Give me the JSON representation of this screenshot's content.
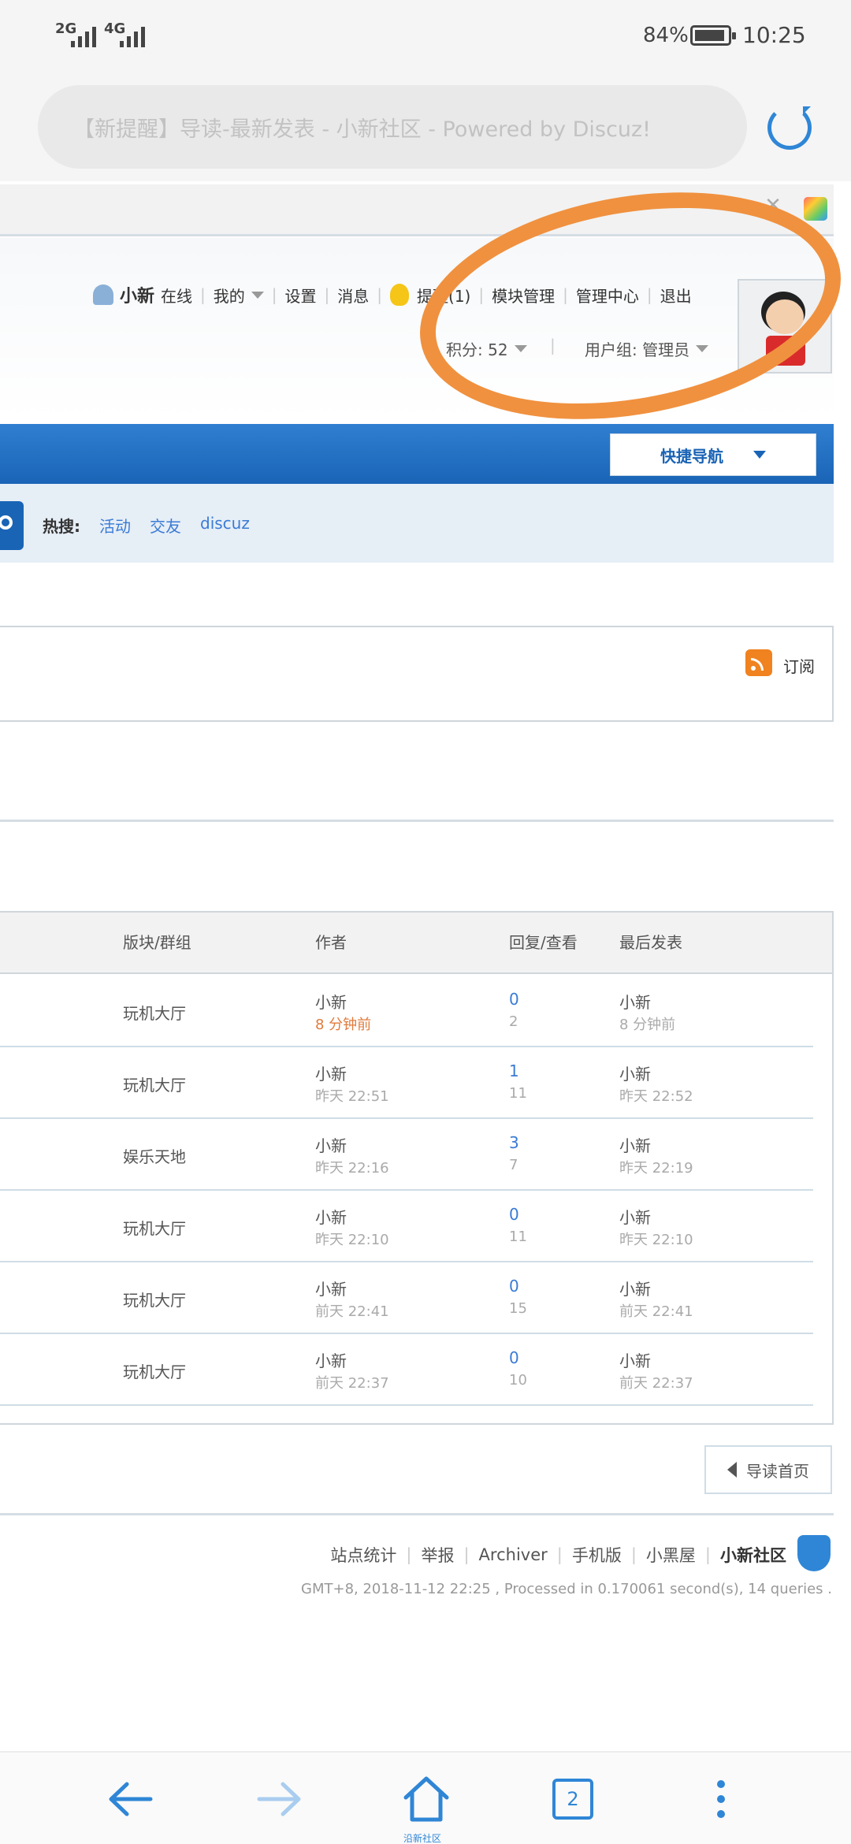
{
  "status_bar": {
    "signal_1": "2G",
    "signal_2": "4G",
    "battery": "84%",
    "time": "10:25"
  },
  "browser": {
    "url_title": "【新提醒】导读-最新发表 - 小新社区 - Powered by Discuz!",
    "tab_count": "2",
    "home_label": "沿新社区"
  },
  "user_bar": {
    "username": "小新",
    "status": "在线",
    "mine": "我的",
    "settings": "设置",
    "messages": "消息",
    "reminder": "提醒(1)",
    "module_admin": "模块管理",
    "admin_center": "管理中心",
    "logout": "退出",
    "points": "积分: 52",
    "user_group": "用户组: 管理员"
  },
  "nav": {
    "quick_nav": "快捷导航"
  },
  "hot_search": {
    "label": "热搜:",
    "items": [
      "活动",
      "交友",
      "discuz"
    ]
  },
  "feed": {
    "subscribe": "订阅"
  },
  "table": {
    "headers": [
      "版块/群组",
      "作者",
      "回复/查看",
      "最后发表"
    ],
    "rows": [
      {
        "forum": "玩机大厅",
        "author": "小新",
        "author_time": "8 分钟前",
        "replies": "0",
        "views": "2",
        "last_author": "小新",
        "last_time": "8 分钟前"
      },
      {
        "forum": "玩机大厅",
        "author": "小新",
        "author_time": "昨天 22:51",
        "replies": "1",
        "views": "11",
        "last_author": "小新",
        "last_time": "昨天 22:52"
      },
      {
        "forum": "娱乐天地",
        "author": "小新",
        "author_time": "昨天 22:16",
        "replies": "3",
        "views": "7",
        "last_author": "小新",
        "last_time": "昨天 22:19"
      },
      {
        "forum": "玩机大厅",
        "author": "小新",
        "author_time": "昨天 22:10",
        "replies": "0",
        "views": "11",
        "last_author": "小新",
        "last_time": "昨天 22:10"
      },
      {
        "forum": "玩机大厅",
        "author": "小新",
        "author_time": "前天 22:41",
        "replies": "0",
        "views": "15",
        "last_author": "小新",
        "last_time": "前天 22:41"
      },
      {
        "forum": "玩机大厅",
        "author": "小新",
        "author_time": "前天 22:37",
        "replies": "0",
        "views": "10",
        "last_author": "小新",
        "last_time": "前天 22:37"
      }
    ]
  },
  "back_home": "导读首页",
  "footer": {
    "links": [
      "站点统计",
      "举报",
      "Archiver",
      "手机版",
      "小黑屋"
    ],
    "site_name": "小新社区",
    "gmt": "GMT+8, 2018-11-12 22:25 , Processed in 0.170061 second(s), 14 queries ."
  },
  "colors": {
    "accent": "#2f86d6",
    "nav_blue": "#1a64b6",
    "annotation": "#f0913f"
  }
}
